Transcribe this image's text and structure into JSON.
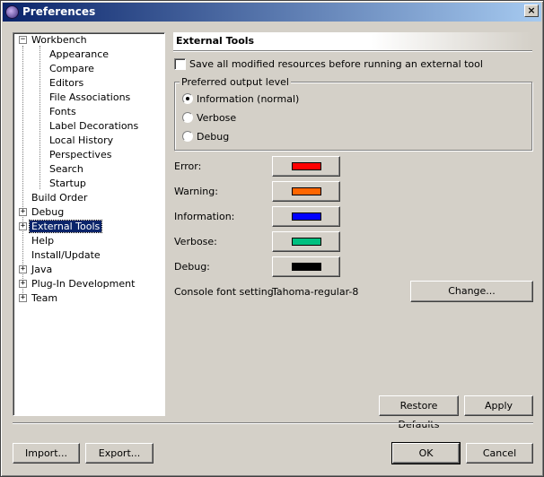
{
  "window": {
    "title": "Preferences",
    "close_label": "×"
  },
  "tree": {
    "items": [
      {
        "label": "Workbench",
        "expander": "−"
      },
      {
        "label": "Appearance"
      },
      {
        "label": "Compare"
      },
      {
        "label": "Editors"
      },
      {
        "label": "File Associations"
      },
      {
        "label": "Fonts"
      },
      {
        "label": "Label Decorations"
      },
      {
        "label": "Local History"
      },
      {
        "label": "Perspectives"
      },
      {
        "label": "Search"
      },
      {
        "label": "Startup"
      },
      {
        "label": "Build Order"
      },
      {
        "label": "Debug",
        "expander": "+"
      },
      {
        "label": "External Tools",
        "expander": "+",
        "selected": true
      },
      {
        "label": "Help"
      },
      {
        "label": "Install/Update"
      },
      {
        "label": "Java",
        "expander": "+"
      },
      {
        "label": "Plug-In Development",
        "expander": "+"
      },
      {
        "label": "Team",
        "expander": "+"
      }
    ]
  },
  "page": {
    "title": "External Tools",
    "save_checkbox": {
      "label": "Save all modified resources before running an external tool",
      "checked": false
    },
    "output_group": {
      "title": "Preferred output level",
      "options": [
        {
          "label": "Information (normal)",
          "selected": true
        },
        {
          "label": "Verbose",
          "selected": false
        },
        {
          "label": "Debug",
          "selected": false
        }
      ]
    },
    "colors": [
      {
        "label": "Error:",
        "color": "#ff0000"
      },
      {
        "label": "Warning:",
        "color": "#ff6600"
      },
      {
        "label": "Information:",
        "color": "#0000ff"
      },
      {
        "label": "Verbose:",
        "color": "#00c080"
      },
      {
        "label": "Debug:",
        "color": "#000000"
      }
    ],
    "console_font": {
      "label": "Console font setting:",
      "value": "Tahoma-regular-8",
      "change_button": "Change..."
    },
    "restore_defaults_button": "Restore Defaults",
    "apply_button": "Apply"
  },
  "footer": {
    "import_button": "Import...",
    "export_button": "Export...",
    "ok_button": "OK",
    "cancel_button": "Cancel"
  }
}
